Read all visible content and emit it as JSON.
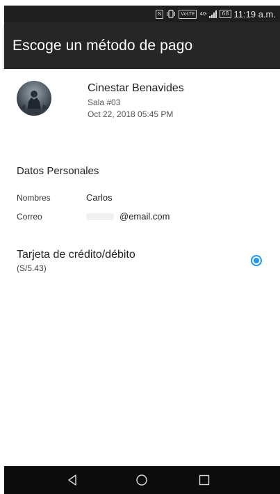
{
  "status_bar": {
    "time": "11:19 a.m.",
    "nfc_icon": "N",
    "vibrate_icon": "vibrate-icon",
    "volte_label": "VoLTE",
    "network_label": "4G",
    "battery_level": "68"
  },
  "app_bar": {
    "title": "Escoge un método de pago"
  },
  "movie": {
    "cinema": "Cinestar Benavides",
    "room": "Sala #03",
    "datetime": "Oct 22, 2018 05:45 PM"
  },
  "personal": {
    "section_title": "Datos Personales",
    "name_label": "Nombres",
    "name_value": "Carlos",
    "email_label": "Correo",
    "email_value": "@email.com"
  },
  "payment": {
    "method_title": "Tarjeta de crédito/débito",
    "amount": "(S/5.43)",
    "selected": true
  },
  "nav": {
    "back_icon": "back-icon",
    "home_icon": "home-icon",
    "recents_icon": "recents-icon"
  },
  "colors": {
    "app_bar": "#262626",
    "status_bar": "#1e1e1e",
    "nav_bar": "#0c0c0c",
    "accent": "#2196f3"
  }
}
